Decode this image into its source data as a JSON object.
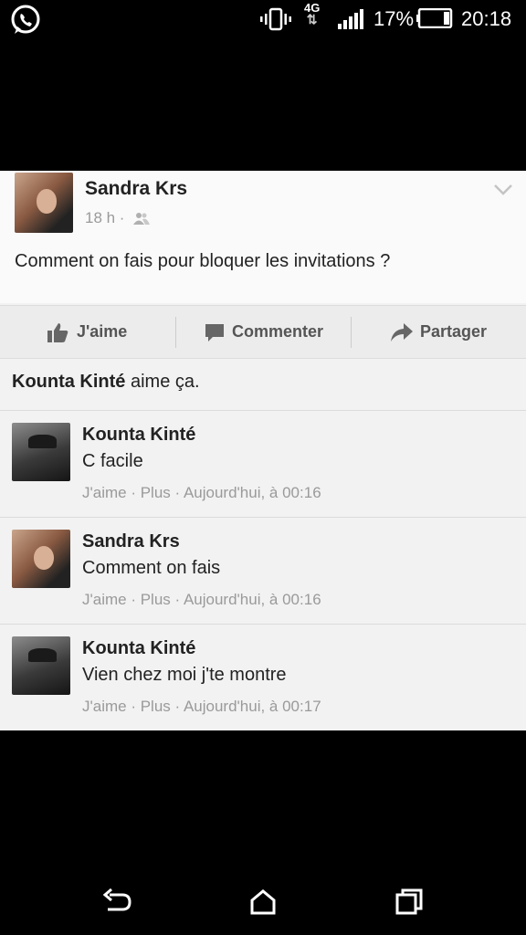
{
  "status_bar": {
    "network": "4G",
    "battery_percent": "17%",
    "time": "20:18",
    "icons": [
      "whatsapp-icon",
      "vibrate-icon",
      "signal-icon",
      "battery-icon"
    ]
  },
  "post": {
    "author": "Sandra Krs",
    "time": "18 h ·",
    "text": "Comment on fais pour bloquer les invitations ?"
  },
  "actions": {
    "like": "J'aime",
    "comment": "Commenter",
    "share": "Partager"
  },
  "likes_summary": {
    "name": "Kounta Kinté",
    "suffix": " aime ça."
  },
  "comments": [
    {
      "author": "Kounta Kinté",
      "text": "C facile",
      "like": "J'aime",
      "more": "Plus",
      "time": "Aujourd'hui, à 00:16"
    },
    {
      "author": "Sandra Krs",
      "text": "Comment on fais",
      "like": "J'aime",
      "more": "Plus",
      "time": "Aujourd'hui, à 00:16"
    },
    {
      "author": "Kounta Kinté",
      "text": "Vien chez moi j'te montre",
      "like": "J'aime",
      "more": "Plus",
      "time": "Aujourd'hui, à 00:17"
    }
  ],
  "meta_separator": " · ",
  "colors": {
    "background": "#000000",
    "card": "#f2f2f2",
    "muted": "#9a9a9a",
    "text": "#222222"
  }
}
